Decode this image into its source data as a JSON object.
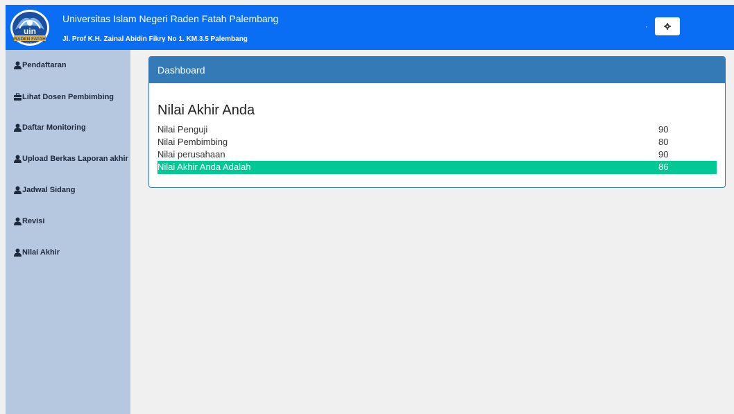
{
  "header": {
    "university_name": "Universitas Islam Negeri Raden Fatah Palembang",
    "address": "Jl. Prof K.H. Zainal Abidin Fikry No 1. KM.3.5 Palembang",
    "logo_text": "uin",
    "logo_subtext": "RADEN FATAH",
    "logo_subtext2": "PALEMBANG",
    "dot": "·",
    "settings_icon": "gear-icon"
  },
  "sidebar": {
    "items": [
      {
        "label": "Pendaftaran",
        "icon": "user-icon"
      },
      {
        "label": "Lihat Dosen Pembimbing",
        "icon": "briefcase-icon"
      },
      {
        "label": "Daftar Monitoring",
        "icon": "user-icon"
      },
      {
        "label": "Upload Berkas Laporan akhir",
        "icon": "user-icon"
      },
      {
        "label": "Jadwal Sidang",
        "icon": "user-icon"
      },
      {
        "label": "Revisi",
        "icon": "user-icon"
      },
      {
        "label": "Nilai Akhir",
        "icon": "user-icon"
      }
    ]
  },
  "panel": {
    "heading": "Dashboard",
    "title": "Nilai Akhir Anda",
    "rows": [
      {
        "label": "Nilai Penguji",
        "value": "90"
      },
      {
        "label": "Nilai Pembimbing",
        "value": "80"
      },
      {
        "label": "Nilai perusahaan",
        "value": "90"
      },
      {
        "label": "Nilai Akhir Anda Adalah",
        "value": "86"
      }
    ]
  },
  "colors": {
    "header_bg": "#0a6ef5",
    "sidebar_bg": "#b6c7e0",
    "panel_heading": "#337ab7",
    "highlight_row": "#02c994"
  }
}
